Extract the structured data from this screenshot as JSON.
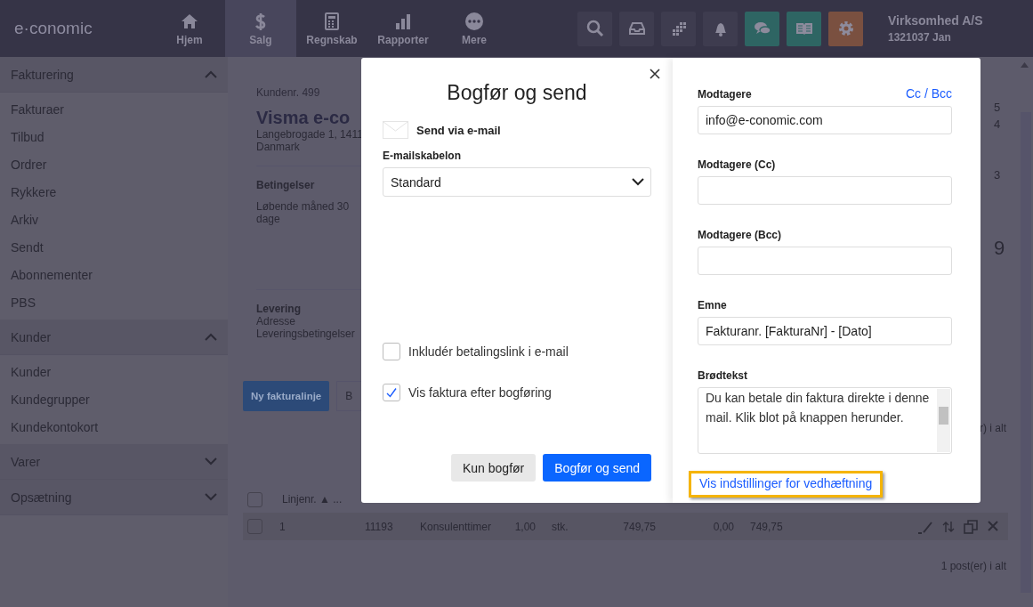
{
  "topbar": {
    "logo": "e·conomic",
    "nav": [
      {
        "label": "Hjem",
        "selected": false
      },
      {
        "label": "Salg",
        "selected": true
      },
      {
        "label": "Regnskab",
        "selected": false
      },
      {
        "label": "Rapporter",
        "selected": false
      },
      {
        "label": "Mere",
        "selected": false
      }
    ],
    "tools": [
      {
        "color": "#3e3c4f"
      },
      {
        "color": "#3e3c4f"
      },
      {
        "color": "#3e3c4f"
      },
      {
        "color": "#3e3c4f"
      },
      {
        "color": "#2e6563"
      },
      {
        "color": "#2e6563"
      },
      {
        "color": "#7a5040"
      }
    ],
    "company": "Virksomhed A/S",
    "account": "1321037 Jan"
  },
  "sidebar": [
    {
      "label": "Fakturering",
      "expanded": true,
      "children": [
        {
          "label": "Fakturaer"
        },
        {
          "label": "Tilbud"
        },
        {
          "label": "Ordrer"
        },
        {
          "label": "Rykkere"
        },
        {
          "label": "Arkiv"
        },
        {
          "label": "Sendt"
        },
        {
          "label": "Abonnementer"
        },
        {
          "label": "PBS"
        }
      ]
    },
    {
      "label": "Kunder",
      "expanded": true,
      "children": [
        {
          "label": "Kunder"
        },
        {
          "label": "Kundegrupper"
        },
        {
          "label": "Kundekontokort"
        }
      ]
    },
    {
      "label": "Varer",
      "expanded": false
    },
    {
      "label": "Opsætning",
      "expanded": false
    }
  ],
  "invoice": {
    "customer_no": "Kundenr. 499",
    "customer_name": "Visma e-co",
    "address": [
      "Langebrogade 1, 1411",
      "Danmark"
    ],
    "terms_heading": "Betingelser",
    "terms": "Løbende måned 30 dage",
    "delivery_heading": "Levering",
    "delivery": [
      "Adresse",
      "Leveringsbetingelser"
    ],
    "right_values": [
      "5",
      "4",
      "3",
      "9"
    ],
    "buttons": [
      "Ny fakturalinje",
      "B"
    ],
    "top_count": "r) i alt",
    "table": {
      "header": "Linjenr. ▲ ...",
      "all_checked": false,
      "rows": [
        {
          "checked": false,
          "cells": [
            "1",
            "11193",
            "Konsulenttimer",
            "1,00",
            "stk.",
            "749,75",
            "0,00",
            "749,75"
          ]
        }
      ]
    },
    "bottom_count": "1 post(er) i alt"
  },
  "dialog": {
    "title": "Bogfør og send",
    "send_label": "Send via e-mail",
    "template_label": "E-mailskabelon",
    "template_value": "Standard",
    "options": [
      {
        "label": "Inkludér betalingslink i e-mail",
        "checked": false
      },
      {
        "label": "Vis faktura efter bogføring",
        "checked": true
      }
    ],
    "buttons": [
      {
        "label": "Kun bogfør",
        "kind": "secondary"
      },
      {
        "label": "Bogfør og send",
        "kind": "primary"
      }
    ],
    "cc_bcc_link": "Cc / Bcc",
    "fields": [
      {
        "label": "Modtagere",
        "value": "info@e-conomic.com"
      },
      {
        "label": "Modtagere (Cc)"
      },
      {
        "label": "Modtagere (Bcc)"
      },
      {
        "label": "Emne",
        "value": "Fakturanr. [FakturaNr] - [Dato]"
      }
    ],
    "body_label": "Brødtekst",
    "body": "Du kan betale din faktura direkte i denne mail. Klik blot på knappen herunder.",
    "attachment_link": "Vis indstillinger for vedhæftning"
  }
}
